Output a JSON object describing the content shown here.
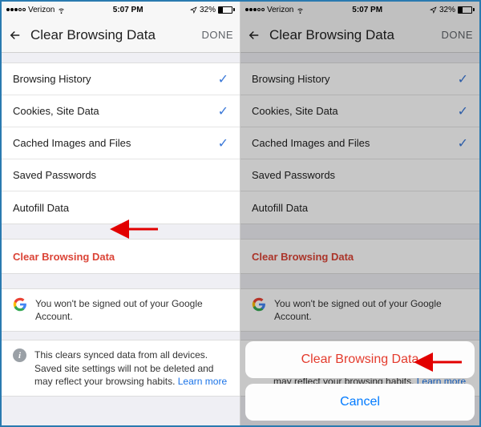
{
  "status": {
    "carrier": "Verizon",
    "time": "5:07 PM",
    "battery_pct": "32%"
  },
  "nav": {
    "title": "Clear Browsing Data",
    "done": "DONE"
  },
  "rows": [
    {
      "label": "Browsing History",
      "checked": true
    },
    {
      "label": "Cookies, Site Data",
      "checked": true
    },
    {
      "label": "Cached Images and Files",
      "checked": true
    },
    {
      "label": "Saved Passwords",
      "checked": false
    },
    {
      "label": "Autofill Data",
      "checked": false
    }
  ],
  "clear_label": "Clear Browsing Data",
  "account_note": "You won't be signed out of your Google Account.",
  "sync_note": "This clears synced data from all devices. Saved site settings will not be deleted and may reflect your browsing habits. ",
  "learn_more": "Learn more",
  "sheet": {
    "destructive": "Clear Browsing Data",
    "cancel": "Cancel"
  }
}
